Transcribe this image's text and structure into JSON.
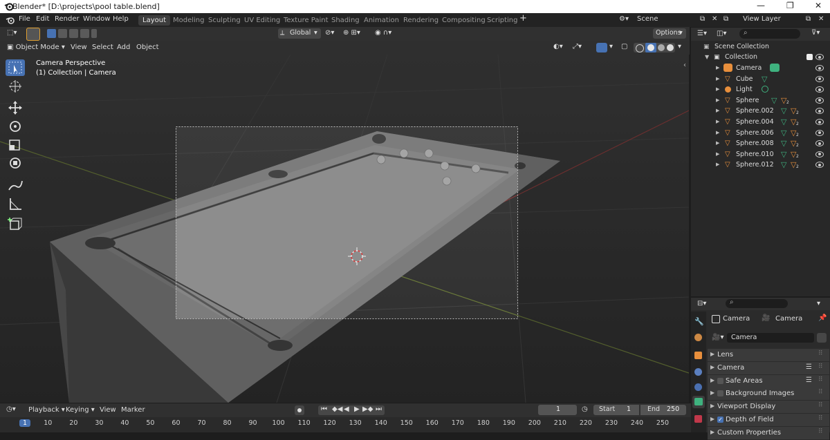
{
  "titlebar": {
    "title": "Blender* [D:\\projects\\pool table.blend]"
  },
  "menu": [
    "File",
    "Edit",
    "Render",
    "Window",
    "Help"
  ],
  "workspaces": [
    "Layout",
    "Modeling",
    "Sculpting",
    "UV Editing",
    "Texture Paint",
    "Shading",
    "Animation",
    "Rendering",
    "Compositing",
    "Scripting"
  ],
  "scene": {
    "name": "Scene",
    "view_layer": "View Layer"
  },
  "header": {
    "orientation": "Global",
    "options": "Options"
  },
  "viewport_header": {
    "mode": "Object Mode",
    "menus": [
      "View",
      "Select",
      "Add",
      "Object"
    ]
  },
  "overlay": {
    "line1": "Camera Perspective",
    "line2": "(1) Collection | Camera"
  },
  "outliner": {
    "root": "Scene Collection",
    "collection": "Collection",
    "items": [
      "Camera",
      "Cube",
      "Light",
      "Sphere",
      "Sphere.002",
      "Sphere.004",
      "Sphere.006",
      "Sphere.008",
      "Sphere.010",
      "Sphere.012"
    ],
    "material_count": "2"
  },
  "properties": {
    "object": "Camera",
    "data": "Camera",
    "data_field": "Camera",
    "panels": [
      "Lens",
      "Camera",
      "Safe Areas",
      "Background Images",
      "Viewport Display",
      "Depth of Field",
      "Custom Properties"
    ],
    "checked": {
      "Depth of Field": true,
      "Safe Areas": false,
      "Background Images": false
    }
  },
  "timeline": {
    "menus": [
      "Playback",
      "Keying",
      "View",
      "Marker"
    ],
    "current_frame": "1",
    "start_label": "Start",
    "start": "1",
    "end_label": "End",
    "end": "250",
    "ticks": [
      "1",
      "10",
      "20",
      "30",
      "40",
      "50",
      "60",
      "70",
      "80",
      "90",
      "100",
      "110",
      "120",
      "130",
      "140",
      "150",
      "160",
      "170",
      "180",
      "190",
      "200",
      "210",
      "220",
      "230",
      "240",
      "250"
    ]
  },
  "colors": {
    "accent": "#4772b3",
    "object_orange": "#e88f3c",
    "data_green": "#3fb27f",
    "viewport_bg": "#3a3a3a"
  }
}
